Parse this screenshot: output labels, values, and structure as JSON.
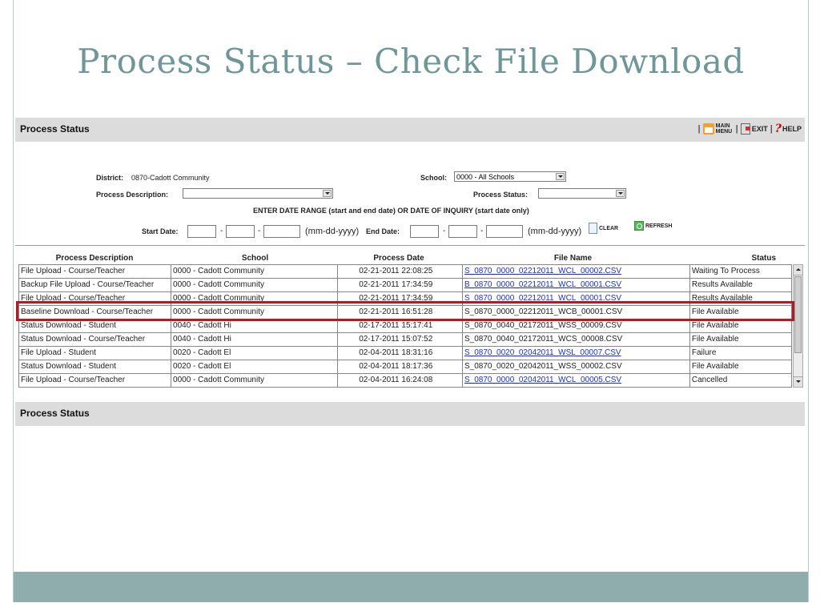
{
  "slide": {
    "title": "Process Status – Check File Download"
  },
  "header": {
    "title": "Process Status",
    "links": {
      "main_menu": "MAIN MENU",
      "exit": "EXIT",
      "help": "HELP",
      "separator": "|"
    }
  },
  "form": {
    "district_label": "District:",
    "district_value": "0870-Cadott Community",
    "school_label": "School:",
    "school_value": "0000 - All Schools",
    "process_desc_label": "Process Description:",
    "process_desc_value": "",
    "process_status_label": "Process Status:",
    "process_status_value": "",
    "date_range_note": "ENTER DATE RANGE (start and end date) OR DATE OF INQUIRY (start date only)",
    "start_date_label": "Start Date:",
    "end_date_label": "End Date:",
    "date_format": "(mm-dd-yyyy)",
    "dash": "-",
    "clear_label": "CLEAR",
    "refresh_label": "REFRESH"
  },
  "grid": {
    "columns": [
      "Process Description",
      "School",
      "Process Date",
      "File Name",
      "Status"
    ],
    "rows": [
      {
        "desc": "File Upload - Course/Teacher",
        "school": "0000 - Cadott Community",
        "date": "02-21-2011 22:08:25",
        "file": "S_0870_0000_02212011_WCL_00002.CSV",
        "link": true,
        "status": "Waiting To Process"
      },
      {
        "desc": "Backup File Upload - Course/Teacher",
        "school": "0000 - Cadott Community",
        "date": "02-21-2011 17:34:59",
        "file": "B_0870_0000_02212011_WCL_00001.CSV",
        "link": true,
        "status": "Results Available"
      },
      {
        "desc": "File Upload - Course/Teacher",
        "school": "0000 - Cadott Community",
        "date": "02-21-2011 17:34:59",
        "file": "S_0870_0000_02212011_WCL_00001.CSV",
        "link": true,
        "status": "Results Available"
      },
      {
        "desc": "Baseline Download - Course/Teacher",
        "school": "0000 - Cadott Community",
        "date": "02-21-2011 16:51:28",
        "file": "S_0870_0000_02212011_WCB_00001.CSV",
        "link": false,
        "status": "File Available"
      },
      {
        "desc": "Status Download - Student",
        "school": "0040 - Cadott Hi",
        "date": "02-17-2011 15:17:41",
        "file": "S_0870_0040_02172011_WSS_00009.CSV",
        "link": false,
        "status": "File Available"
      },
      {
        "desc": "Status Download - Course/Teacher",
        "school": "0040 - Cadott Hi",
        "date": "02-17-2011 15:07:52",
        "file": "S_0870_0040_02172011_WCS_00008.CSV",
        "link": false,
        "status": "File Available"
      },
      {
        "desc": "File Upload - Student",
        "school": "0020 - Cadott El",
        "date": "02-04-2011 18:31:16",
        "file": "S_0870_0020_02042011_WSL_00007.CSV",
        "link": true,
        "status": "Failure"
      },
      {
        "desc": "Status Download - Student",
        "school": "0020 - Cadott El",
        "date": "02-04-2011 18:17:36",
        "file": "S_0870_0020_02042011_WSS_00002.CSV",
        "link": false,
        "status": "File Available"
      },
      {
        "desc": "File Upload - Course/Teacher",
        "school": "0000 - Cadott Community",
        "date": "02-04-2011 16:24:08",
        "file": "S_0870_0000_02042011_WCL_00005.CSV",
        "link": true,
        "status": "Cancelled"
      }
    ]
  },
  "footer_section": {
    "title": "Process Status"
  },
  "colors": {
    "title": "#6f9797",
    "band": "#8fadad",
    "highlight": "#b01c22",
    "link": "#1a2fd8"
  }
}
